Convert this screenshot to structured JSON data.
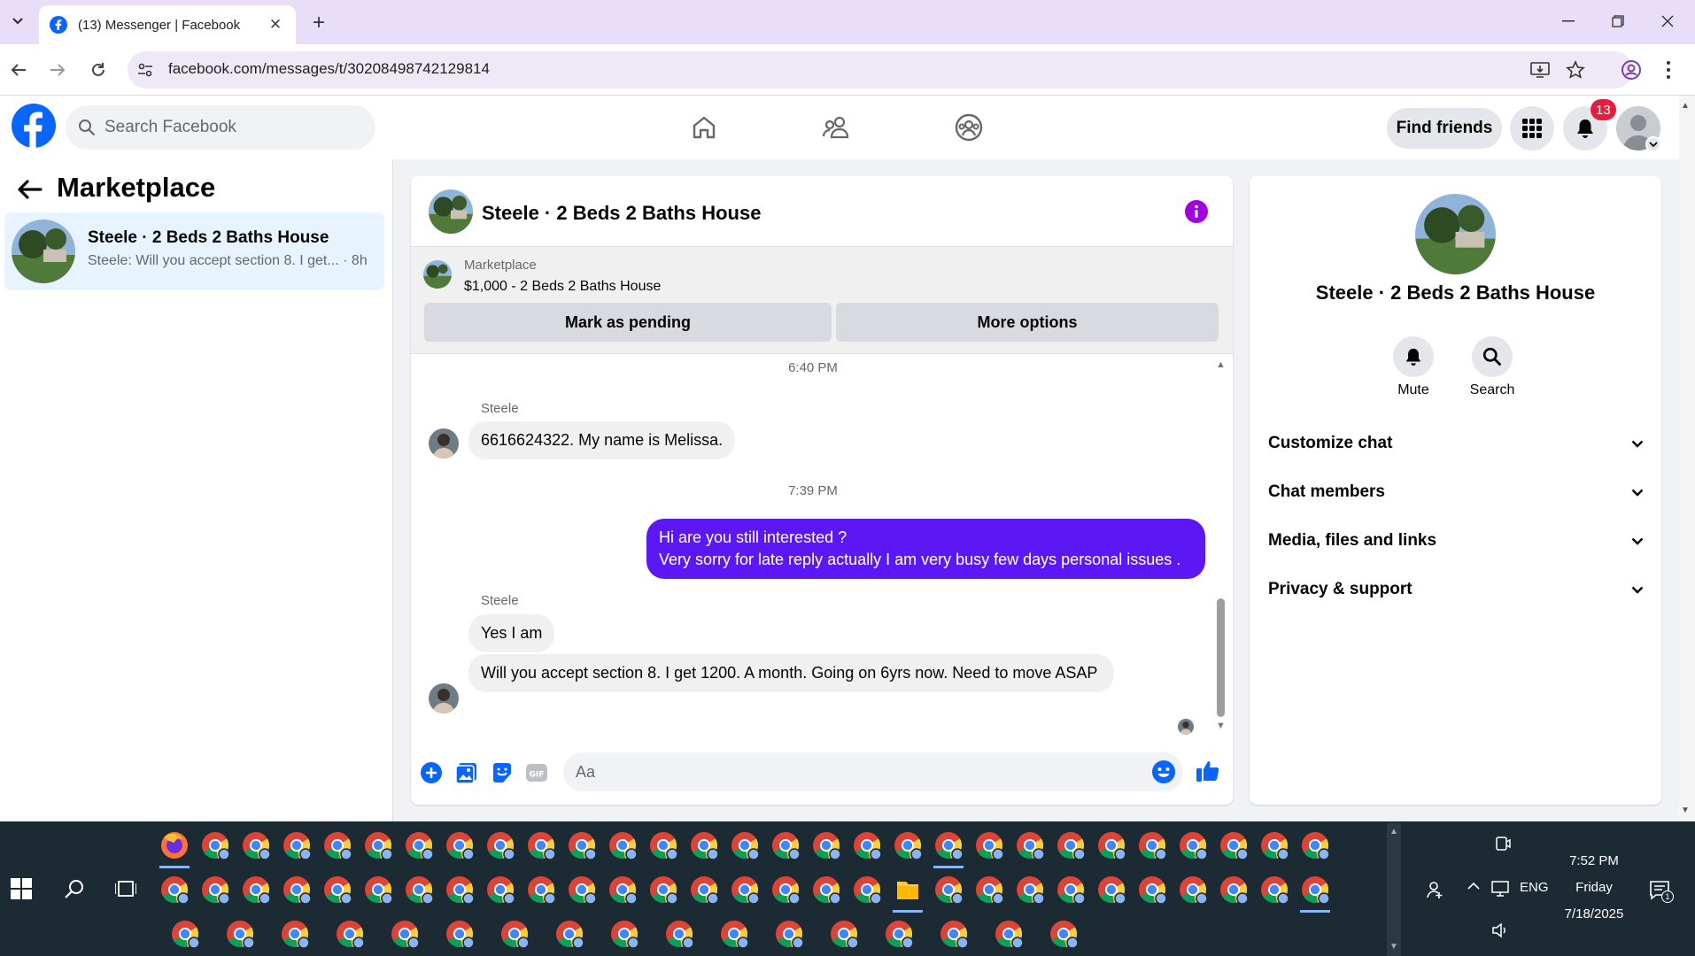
{
  "browser": {
    "tab_title": "(13) Messenger | Facebook",
    "url": "facebook.com/messages/t/30208498742129814"
  },
  "header": {
    "search_placeholder": "Search Facebook",
    "find_friends_label": "Find friends",
    "notification_count": "13"
  },
  "left_panel": {
    "title": "Marketplace",
    "conversations": [
      {
        "title": "Steele · 2 Beds 2 Baths House",
        "preview": "Steele: Will you accept section 8. I get...",
        "time": "· 8h"
      }
    ]
  },
  "chat": {
    "title": "Steele · 2 Beds 2 Baths House",
    "listing": {
      "label": "Marketplace",
      "price_title": "$1,000 - 2 Beds 2 Baths House",
      "mark_pending_label": "Mark as pending",
      "more_options_label": "More options"
    },
    "messages": {
      "ts1": "6:40 PM",
      "sender1": "Steele",
      "msg1": "6616624322. My name is Melissa.",
      "ts2": "7:39 PM",
      "out_line1": "Hi are you still interested ?",
      "out_line2": "Very sorry for late reply actually I am very busy few days personal issues .",
      "sender2": "Steele",
      "msg2": "Yes I am",
      "msg3": "Will you accept section 8. I get 1200. A month. Going on 6yrs now. Need to move ASAP"
    },
    "composer_placeholder": "Aa"
  },
  "right_panel": {
    "title": "Steele · 2 Beds 2 Baths House",
    "mute_label": "Mute",
    "search_label": "Search",
    "sections": [
      "Customize chat",
      "Chat members",
      "Media, files and links",
      "Privacy & support"
    ]
  },
  "taskbar": {
    "time": "7:52 PM",
    "day": "Friday",
    "date": "7/18/2025",
    "lang": "ENG",
    "notif_count": "1"
  },
  "colors": {
    "fb_blue": "#0866ff",
    "messenger_purple": "#5b18f5",
    "badge_red": "#e41e3f"
  }
}
